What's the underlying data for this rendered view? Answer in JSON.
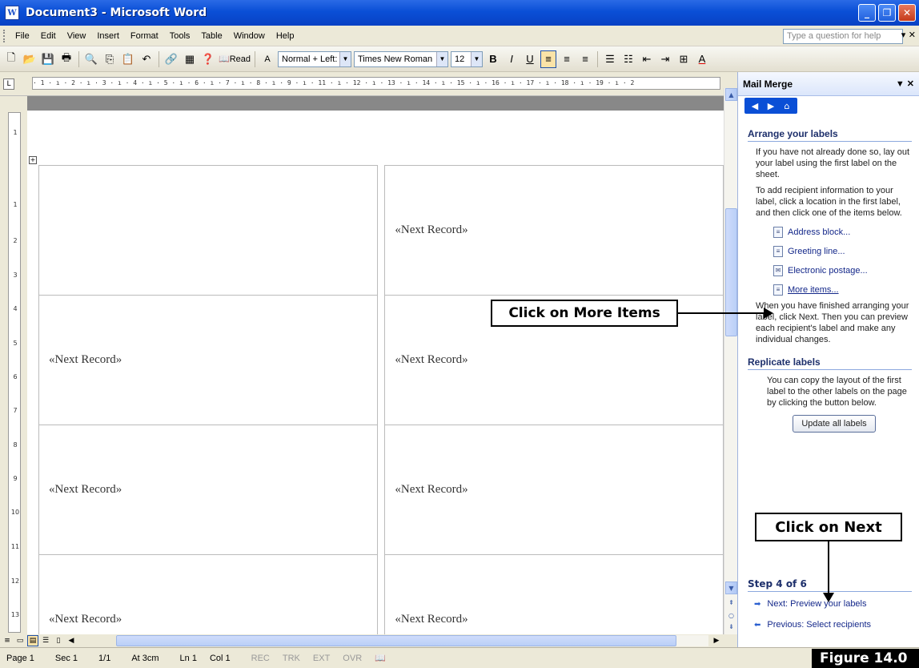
{
  "window": {
    "title": "Document3 - Microsoft Word",
    "minimize": "_",
    "restore": "❐",
    "close": "✕"
  },
  "menu": {
    "items": [
      "File",
      "Edit",
      "View",
      "Insert",
      "Format",
      "Tools",
      "Table",
      "Window",
      "Help"
    ],
    "help_placeholder": "Type a question for help",
    "help_arrow": "▾ ✕"
  },
  "toolbar": {
    "read_label": "Read",
    "style_value": "Normal + Left:",
    "font_value": "Times New Roman",
    "size_value": "12",
    "bold": "B",
    "italic": "I",
    "underline": "U",
    "font_color": "A"
  },
  "ruler": {
    "h_numbers": "· 1 · ı · 2 · ı · 3 · ı · 4 · ı · 5 · ı · 6 · ı · 7 · ı · 8 · ı · 9 · ı · 11 · ı · 12 · ı · 13 · ı · 14 · ı · 15 · ı · 16 · ı · 17 · ı · 18 · ı · 19 · ı · 2",
    "v_numbers": [
      "1",
      "1",
      "2",
      "3",
      "4",
      "5",
      "6",
      "7",
      "8",
      "9",
      "10",
      "11",
      "12",
      "13"
    ]
  },
  "document": {
    "cells": [
      [
        "",
        "«Next Record»"
      ],
      [
        "«Next Record»",
        "«Next Record»"
      ],
      [
        "«Next Record»",
        "«Next Record»"
      ],
      [
        "«Next Record»",
        "«Next Record»"
      ]
    ]
  },
  "status": {
    "page": "Page 1",
    "sec": "Sec 1",
    "pages": "1/1",
    "at": "At 3cm",
    "ln": "Ln 1",
    "col": "Col 1",
    "rec": "REC",
    "trk": "TRK",
    "ext": "EXT",
    "ovr": "OVR"
  },
  "pane": {
    "title": "Mail Merge",
    "controls": "▼ ✕",
    "section1_title": "Arrange your labels",
    "para1": "If you have not already done so, lay out your label using the first label on the sheet.",
    "para2": "To add recipient information to your label, click a location in the first label, and then click one of the items below.",
    "links": [
      "Address block...",
      "Greeting line...",
      "Electronic postage...",
      "More items..."
    ],
    "para3": "When you have finished arranging your label, click Next. Then you can preview each recipient's label and make any individual changes.",
    "section2_title": "Replicate labels",
    "para4": "You can copy the layout of the first label to the other labels on the page by clicking the button below.",
    "update_button": "Update all labels",
    "step": "Step 4 of 6",
    "next_link": "Next: Preview your labels",
    "prev_link": "Previous: Select recipients"
  },
  "annotations": {
    "callout_more": "Click on More Items",
    "callout_next": "Click on Next",
    "figure": "Figure 14.0"
  }
}
